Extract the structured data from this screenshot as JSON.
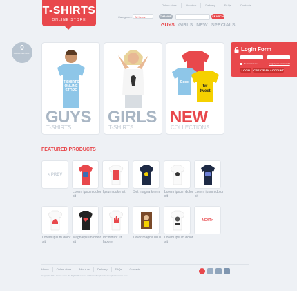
{
  "logo": {
    "title": "T-SHIRTS",
    "subtitle": "ONLINE STORE"
  },
  "topnav": [
    "Online store",
    "About us",
    "Delivery",
    "FAQs",
    "Contacts"
  ],
  "search": {
    "category_label": "Categories:",
    "category_value": "All Items",
    "change_label": "CHANGE",
    "search_label": "SEARCH"
  },
  "catnav": [
    "GUYS",
    "GIRLS",
    "NEW",
    "SPECIALS"
  ],
  "cart": {
    "count": "0",
    "label": "SHOPPING CART"
  },
  "hero": [
    {
      "title": "GUYS",
      "subtitle": "T-SHIRTS"
    },
    {
      "title": "GIRLS",
      "subtitle": "T-SHIRTS"
    },
    {
      "title": "NEW",
      "subtitle": "COLLECTIONS"
    }
  ],
  "login": {
    "title": "Login Form",
    "remember": "Remember me",
    "forgot": "Forgot your password?",
    "login_btn": "LOGIN",
    "create_btn": "CREATE AN ACCOUNT"
  },
  "featured": {
    "title": "FEATURED PRODUCTS",
    "prev": "< PREV",
    "next": "NEXT>",
    "row1": [
      {
        "label": "Lorem ipsum dolor sit",
        "color": "#e8484c"
      },
      {
        "label": "Ipsum dolor sit",
        "color": "#ffffff"
      },
      {
        "label": "Set magna lorem",
        "color": "#1e2a45"
      },
      {
        "label": "Lorem ipsum dolor sit",
        "color": "#ffffff"
      },
      {
        "label": "Lorem ipsum dolor sit",
        "color": "#1e2a45"
      }
    ],
    "row2": [
      {
        "label": "Lorem ipsum dolor sit",
        "color": "#ffffff"
      },
      {
        "label": "Magnaipsum dolor sit",
        "color": "#222222"
      },
      {
        "label": "Incididunt ut labore",
        "color": "#ffffff"
      },
      {
        "label": "Dolor magna ullus",
        "color": "#7a4a2a"
      },
      {
        "label": "Lorem ipsum dolor sit",
        "color": "#ffffff"
      }
    ]
  },
  "footer": {
    "nav": [
      "Home",
      "Online store",
      "About us",
      "Delivery",
      "FAQs",
      "Contacts"
    ],
    "copyright": "Copyright 2011 Online store. All Rights Reserved. Website Template by TemplateMonster.com"
  },
  "colors": {
    "accent": "#e8484c",
    "muted": "#a9b6c4",
    "background": "#eef1f5"
  }
}
